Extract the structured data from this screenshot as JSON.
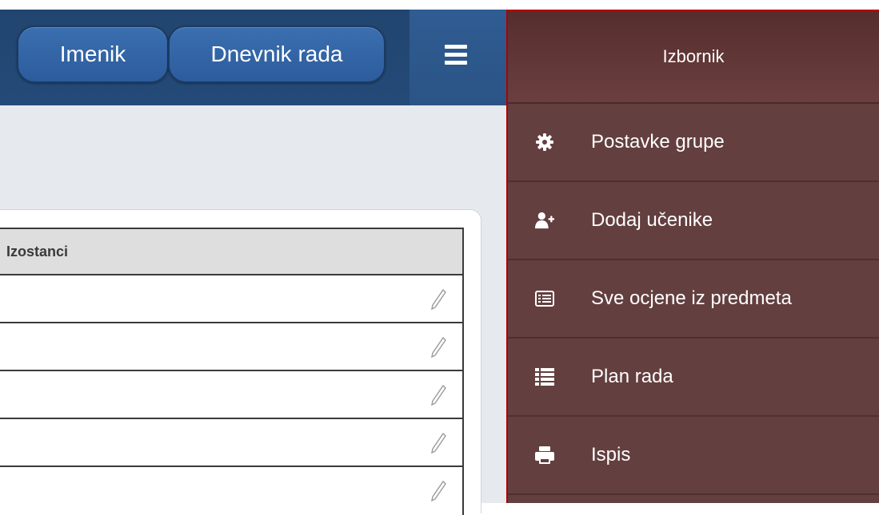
{
  "topbar": {
    "buttons": [
      {
        "label": "Imenik"
      },
      {
        "label": "Dnevnik rada"
      }
    ],
    "menu_icon": "hamburger-icon"
  },
  "table": {
    "header": "Izostanci",
    "rows": [
      "",
      "",
      "",
      "",
      ""
    ],
    "row_icon": "pencil-icon"
  },
  "menu": {
    "title": "Izbornik",
    "items": [
      {
        "label": "Postavke grupe",
        "icon": "gear-icon"
      },
      {
        "label": "Dodaj učenike",
        "icon": "add-user-icon"
      },
      {
        "label": "Sve ocjene iz predmeta",
        "icon": "grades-icon"
      },
      {
        "label": "Plan rada",
        "icon": "list-icon"
      },
      {
        "label": "Ispis",
        "icon": "print-icon"
      }
    ]
  },
  "colors": {
    "topbar": "#2b5486",
    "menu_bg": "#643f3f",
    "menu_border": "#b00000"
  }
}
